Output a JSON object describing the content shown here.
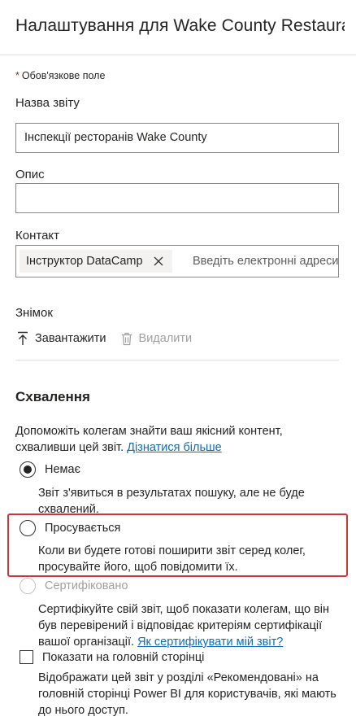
{
  "header": {
    "title": "Налаштування для Wake County Restaurant Inspections"
  },
  "form": {
    "required_star": "*",
    "required_note": "Обов'язкове поле",
    "report_name": {
      "label": "Назва звіту",
      "value": "Інспекції ресторанів Wake County"
    },
    "description": {
      "label": "Опис",
      "value": ""
    },
    "contact": {
      "label": "Контакт",
      "chip": "Інструктор DataCamp",
      "placeholder": "Введіть електронні адреси"
    },
    "snapshot": {
      "label": "Знімок",
      "upload_label": "Завантажити",
      "delete_label": "Видалити"
    }
  },
  "endorsement": {
    "title": "Схвалення",
    "intro": "Допоможіть колегам знайти ваш якісний контент, схваливши цей звіт.",
    "learn_more": "Дізнатися більше",
    "options": [
      {
        "label": "Немає",
        "description": "Звіт з'явиться в результатах пошуку, але не буде схвалений.",
        "checked": true,
        "disabled": false
      },
      {
        "label": "Просувається",
        "description": "Коли ви будете готові поширити звіт серед колег, просувайте його, щоб повідомити їх.",
        "checked": false,
        "disabled": false
      },
      {
        "label": "Сертифіковано",
        "description": "Сертифікуйте свій звіт, щоб показати колегам, що він був перевірений і відповідає критеріям сертифікації вашої організації.",
        "link": "Як сертифікувати мій звіт?",
        "checked": false,
        "disabled": true
      }
    ],
    "featured": {
      "label": "Показати на головній сторінці",
      "description": "Відображати цей звіт у розділі «Рекомендовані» на головній сторінці Power BI для користувачів, які мають до нього доступ.",
      "checked": false
    }
  },
  "colors": {
    "accent_link": "#0f6cbd",
    "highlight_border": "#d13438",
    "required": "#a4262c"
  }
}
